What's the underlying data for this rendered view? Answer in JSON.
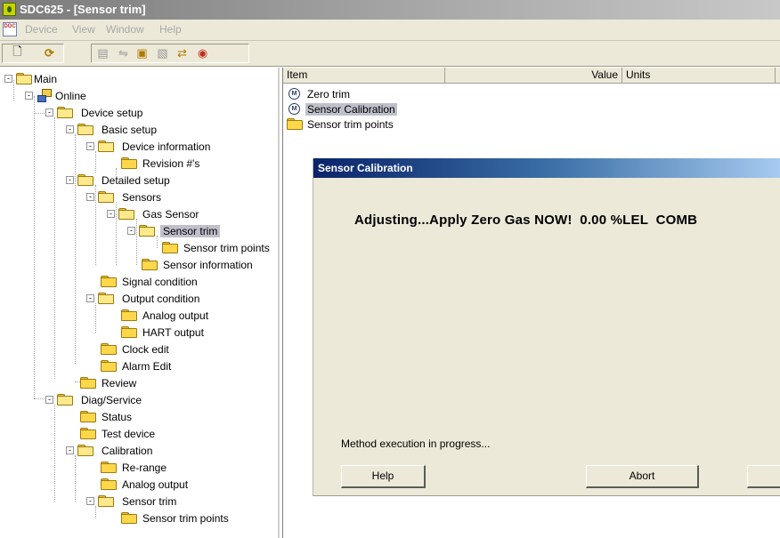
{
  "window": {
    "title": "SDC625 - [Sensor trim]"
  },
  "menu": {
    "items": [
      "Device",
      "View",
      "Window",
      "Help"
    ]
  },
  "toolbar": {
    "buttons": [
      "new-document-icon",
      "online-icon",
      "save-icon",
      "sync-icon",
      "device-icon",
      "print-icon",
      "navigate-icon",
      "stop-icon"
    ]
  },
  "tree": {
    "main": "Main",
    "online": "Online",
    "device_setup": "Device setup",
    "basic_setup": "Basic setup",
    "device_information": "Device information",
    "revision": "Revision #'s",
    "detailed_setup": "Detailed setup",
    "sensors": "Sensors",
    "gas_sensor": "Gas Sensor",
    "sensor_trim": "Sensor trim",
    "sensor_trim_points": "Sensor trim points",
    "sensor_information": "Sensor information",
    "signal_condition": "Signal condition",
    "output_condition": "Output condition",
    "analog_output": "Analog output",
    "hart_output": "HART output",
    "clock_edit": "Clock edit",
    "alarm_edit": "Alarm Edit",
    "review": "Review",
    "diag_service": "Diag/Service",
    "status": "Status",
    "test_device": "Test device",
    "calibration": "Calibration",
    "re_range": "Re-range",
    "cal_analog_output": "Analog output",
    "cal_sensor_trim": "Sensor trim",
    "cal_sensor_trim_points": "Sensor trim points"
  },
  "list": {
    "columns": {
      "item": "Item",
      "value": "Value",
      "units": "Units"
    },
    "rows": [
      {
        "label": "Zero trim",
        "icon": "method-icon"
      },
      {
        "label": "Sensor Calibration",
        "icon": "method-icon",
        "selected": true
      },
      {
        "label": "Sensor trim points",
        "icon": "folder-icon"
      }
    ]
  },
  "dialog": {
    "title": "Sensor Calibration",
    "message": "Adjusting...Apply Zero Gas NOW!  0.00 %LEL  COMB",
    "status": "Method execution in progress...",
    "help_label": "Help",
    "abort_label": "Abort",
    "next_label": ""
  },
  "colors": {
    "dialog_title_start": "#0a246a",
    "dialog_title_end": "#a6caf0",
    "window_title_start": "#7a7a7a",
    "folder": "#ffd84a",
    "chrome": "#ece9d8",
    "selection": "#c0c0cc"
  }
}
